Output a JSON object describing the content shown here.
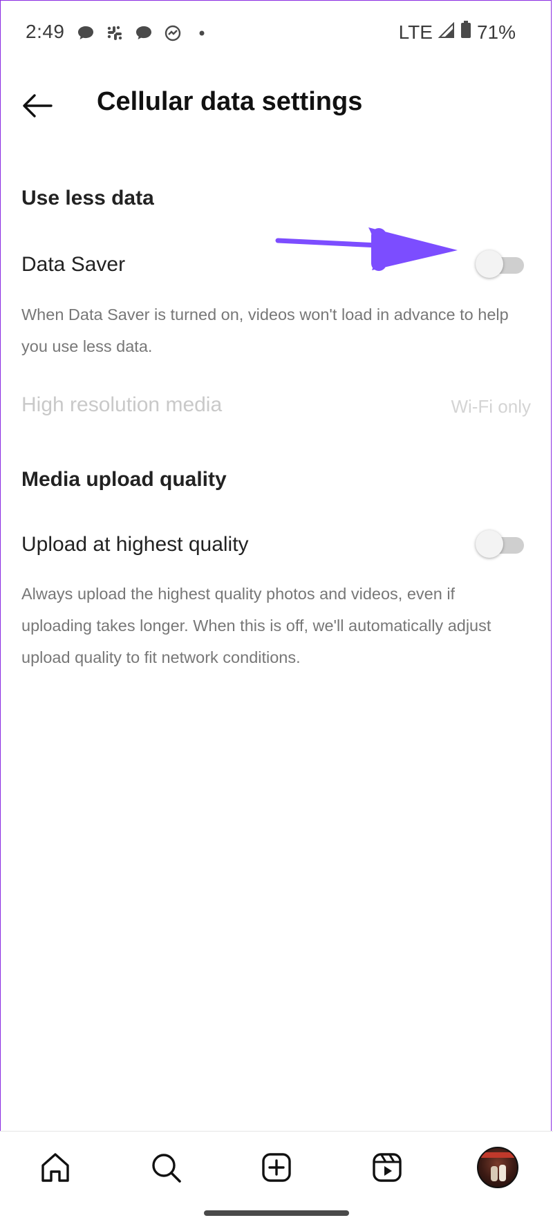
{
  "status_bar": {
    "time": "2:49",
    "network": "LTE",
    "battery": "71%",
    "notification_icons": [
      "chat-icon",
      "slack-icon",
      "chat-icon",
      "activity-icon",
      "dot-icon"
    ]
  },
  "header": {
    "title": "Cellular data settings",
    "back_icon": "arrow-left-icon"
  },
  "use_less_data": {
    "title": "Use less data",
    "data_saver": {
      "label": "Data Saver",
      "enabled": false,
      "description": "When Data Saver is turned on, videos won't load in advance to help you use less data."
    },
    "high_res_media": {
      "label": "High resolution media",
      "value": "Wi-Fi only",
      "disabled": true
    }
  },
  "media_upload": {
    "title": "Media upload quality",
    "upload_highest": {
      "label": "Upload at highest quality",
      "enabled": false,
      "description": "Always upload the highest quality photos and videos, even if uploading takes longer. When this is off, we'll automatically adjust upload quality to fit network conditions."
    }
  },
  "annotation": {
    "arrow_color": "#7c4dff"
  },
  "bottom_nav": {
    "items": [
      "home-icon",
      "search-icon",
      "create-icon",
      "reels-icon",
      "profile-avatar"
    ]
  },
  "colors": {
    "text_primary": "#222222",
    "text_secondary": "#777777",
    "text_disabled": "#c9c9c9"
  }
}
